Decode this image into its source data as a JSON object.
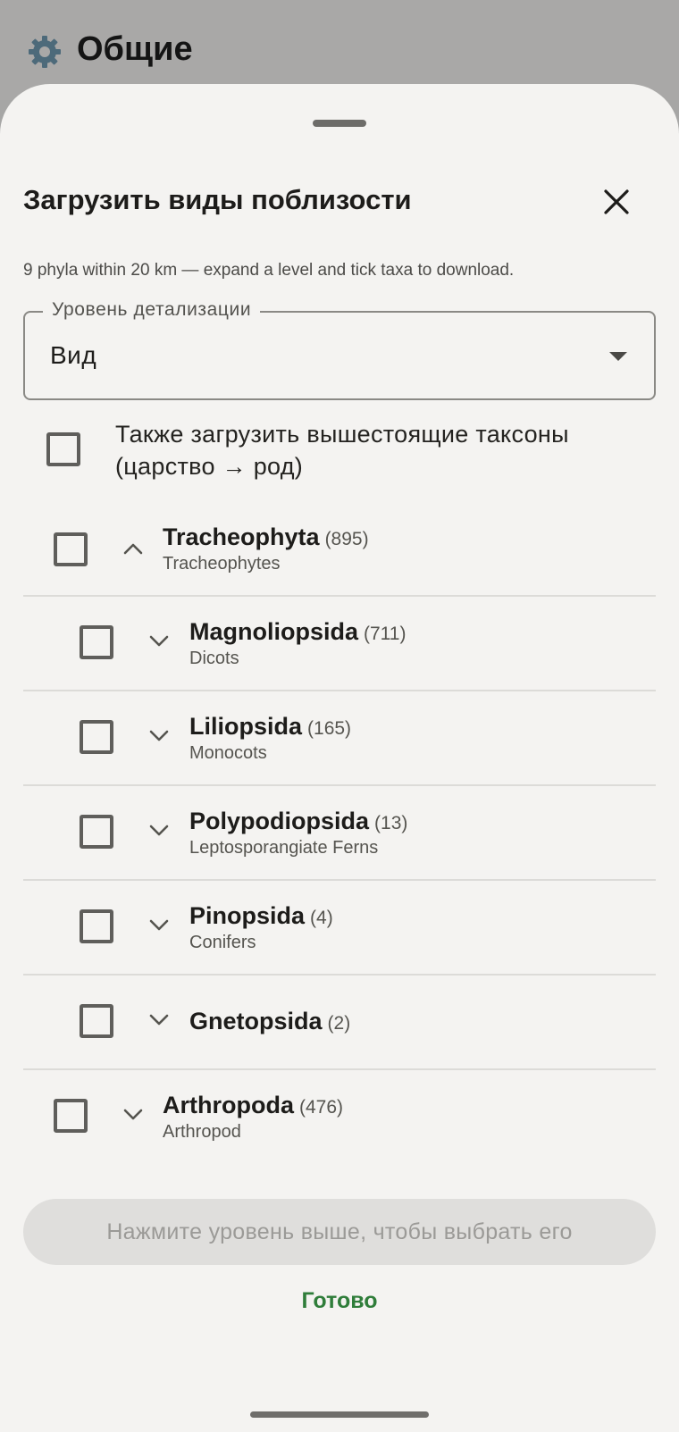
{
  "topbar": {
    "title": "Общие",
    "icon": "gear-icon"
  },
  "sheet": {
    "title": "Загрузить виды поблизости",
    "subtitle": "9 phyla within 20 km — expand a level and tick taxa to download.",
    "close_icon": "close-icon"
  },
  "select": {
    "label": "Уровень детализации",
    "value": "Вид"
  },
  "also_download": {
    "label": "Также загрузить вышестоящие таксоны (царство → род)",
    "checked": false
  },
  "tree": [
    {
      "name": "Tracheophyta",
      "count": "(895)",
      "common": "Tracheophytes",
      "expanded": true,
      "level": 0,
      "checked": false
    },
    {
      "name": "Magnoliopsida",
      "count": "(711)",
      "common": "Dicots",
      "expanded": false,
      "level": 1,
      "checked": false
    },
    {
      "name": "Liliopsida",
      "count": "(165)",
      "common": "Monocots",
      "expanded": false,
      "level": 1,
      "checked": false
    },
    {
      "name": "Polypodiopsida",
      "count": "(13)",
      "common": "Leptosporangiate Ferns",
      "expanded": false,
      "level": 1,
      "checked": false
    },
    {
      "name": "Pinopsida",
      "count": "(4)",
      "common": "Conifers",
      "expanded": false,
      "level": 1,
      "checked": false
    },
    {
      "name": "Gnetopsida",
      "count": "(2)",
      "common": "",
      "expanded": false,
      "level": 1,
      "checked": false
    },
    {
      "name": "Arthropoda",
      "count": "(476)",
      "common": "Arthropod",
      "expanded": false,
      "level": 0,
      "checked": false
    }
  ],
  "actions": {
    "primary_label": "Нажмите уровень выше, чтобы выбрать его",
    "done_label": "Готово"
  },
  "colors": {
    "accent": "#2f7d3a",
    "sheet_bg": "#f4f3f1",
    "scrim": "#a6a6a5"
  }
}
